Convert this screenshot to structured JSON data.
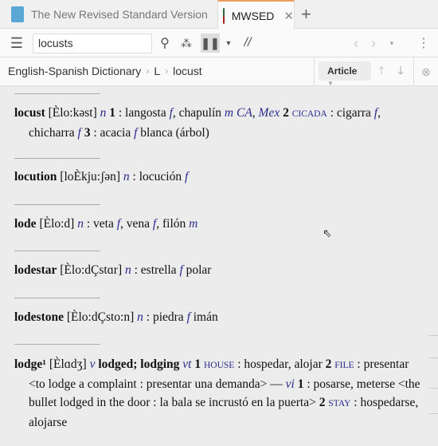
{
  "tabs": [
    {
      "label": "The New Revised Standard Version",
      "icon": "bible-book-icon",
      "active": false
    },
    {
      "label": "MWSED",
      "icon": "dictionary-book-icon",
      "active": true
    }
  ],
  "toolbar": {
    "search_value": "locusts"
  },
  "breadcrumb": [
    "English-Spanish Dictionary",
    "L",
    "locust"
  ],
  "article_label": "Article",
  "colors": {
    "accent": "#2a2a8c",
    "tab_accent": "#e8a060"
  },
  "entries": [
    {
      "segments": [
        [
          "hw",
          "locust"
        ],
        [
          "t",
          " [Èlo:kəst] "
        ],
        [
          "it",
          "n"
        ],
        [
          "t",
          " "
        ],
        [
          "num",
          "1"
        ],
        [
          "t",
          " : langosta "
        ],
        [
          "it",
          "f"
        ],
        [
          "t",
          ", chapulín "
        ],
        [
          "it",
          "m CA"
        ],
        [
          "t",
          ", "
        ],
        [
          "it",
          "Mex"
        ],
        [
          "t",
          " "
        ],
        [
          "num",
          "2"
        ],
        [
          "t",
          " "
        ],
        [
          "sc",
          "CICADA"
        ],
        [
          "t",
          " : cigarra "
        ],
        [
          "it",
          "f"
        ],
        [
          "t",
          ", chicharra "
        ],
        [
          "it",
          "f"
        ],
        [
          "t",
          " "
        ],
        [
          "num",
          "3"
        ],
        [
          "t",
          " : acacia "
        ],
        [
          "it",
          "f"
        ],
        [
          "t",
          " blanca (árbol)"
        ]
      ]
    },
    {
      "segments": [
        [
          "hw",
          "locution"
        ],
        [
          "t",
          " [loÈkju:ʃən] "
        ],
        [
          "it",
          "n"
        ],
        [
          "t",
          " : locución "
        ],
        [
          "it",
          "f"
        ]
      ]
    },
    {
      "segments": [
        [
          "hw",
          "lode"
        ],
        [
          "t",
          " [Èlo:d] "
        ],
        [
          "it",
          "n"
        ],
        [
          "t",
          " : veta "
        ],
        [
          "it",
          "f"
        ],
        [
          "t",
          ", vena "
        ],
        [
          "it",
          "f"
        ],
        [
          "t",
          ", filón "
        ],
        [
          "it",
          "m"
        ]
      ]
    },
    {
      "segments": [
        [
          "hw",
          "lodestar"
        ],
        [
          "t",
          " [Èlo:dÇstɑr] "
        ],
        [
          "it",
          "n"
        ],
        [
          "t",
          " : estrella "
        ],
        [
          "it",
          "f"
        ],
        [
          "t",
          " polar"
        ]
      ]
    },
    {
      "segments": [
        [
          "hw",
          "lodestone"
        ],
        [
          "t",
          " [Èlo:dÇsto:n] "
        ],
        [
          "it",
          "n"
        ],
        [
          "t",
          " : piedra "
        ],
        [
          "it",
          "f"
        ],
        [
          "t",
          " imán"
        ]
      ]
    },
    {
      "segments": [
        [
          "hw",
          "lodge¹"
        ],
        [
          "t",
          " [Èlɑdʒ] "
        ],
        [
          "it",
          "v"
        ],
        [
          "t",
          " "
        ],
        [
          "hw",
          "lodged; lodging"
        ],
        [
          "t",
          " "
        ],
        [
          "it",
          "vt"
        ],
        [
          "t",
          " "
        ],
        [
          "num",
          "1"
        ],
        [
          "t",
          " "
        ],
        [
          "sc",
          "HOUSE"
        ],
        [
          "t",
          " : hospedar, alojar "
        ],
        [
          "num",
          "2"
        ],
        [
          "t",
          " "
        ],
        [
          "sc",
          "FILE"
        ],
        [
          "t",
          " : presentar <to lodge a complaint : presentar una demanda> — "
        ],
        [
          "it",
          "vi"
        ],
        [
          "t",
          " "
        ],
        [
          "num",
          "1"
        ],
        [
          "t",
          " : posarse, meterse <the bullet lodged in the door : la bala se incrustó en la puerta> "
        ],
        [
          "num",
          "2"
        ],
        [
          "t",
          " "
        ],
        [
          "sc",
          "STAY"
        ],
        [
          "t",
          " : hospedarse, alojarse"
        ]
      ]
    }
  ]
}
